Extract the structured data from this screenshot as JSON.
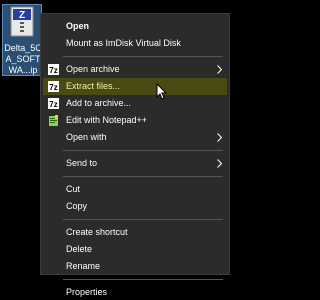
{
  "desktop": {
    "file_label": "Delta_5CA_SOFTWA...ip",
    "file_icon": "zip-archive-icon"
  },
  "menu": {
    "open": "Open",
    "mount": "Mount as ImDisk Virtual Disk",
    "open_archive": "Open archive",
    "extract_files": "Extract files...",
    "add_to_archive": "Add to archive...",
    "edit_notepad": "Edit with Notepad++",
    "open_with": "Open with",
    "send_to": "Send to",
    "cut": "Cut",
    "copy": "Copy",
    "create_shortcut": "Create shortcut",
    "delete": "Delete",
    "rename": "Rename",
    "properties": "Properties",
    "hover_color": "#4a4a15",
    "background_color": "#2b2b2b"
  }
}
